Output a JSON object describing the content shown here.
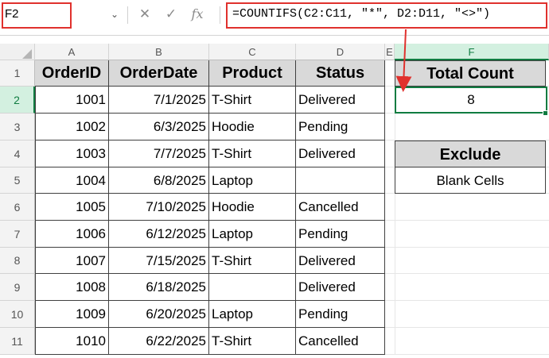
{
  "name_box": {
    "value": "F2"
  },
  "formula_bar": {
    "formula": "=COUNTIFS(C2:C11, \"*\", D2:D11, \"<>\")",
    "fx_label": "fx"
  },
  "columns": [
    "A",
    "B",
    "C",
    "D",
    "E",
    "F"
  ],
  "rows": [
    "1",
    "2",
    "3",
    "4",
    "5",
    "6",
    "7",
    "8",
    "9",
    "10",
    "11"
  ],
  "table": {
    "headers": [
      "OrderID",
      "OrderDate",
      "Product",
      "Status"
    ],
    "rows": [
      [
        "1001",
        "7/1/2025",
        "T-Shirt",
        "Delivered"
      ],
      [
        "1002",
        "6/3/2025",
        "Hoodie",
        "Pending"
      ],
      [
        "1003",
        "7/7/2025",
        "T-Shirt",
        "Delivered"
      ],
      [
        "1004",
        "6/8/2025",
        "Laptop",
        ""
      ],
      [
        "1005",
        "7/10/2025",
        "Hoodie",
        "Cancelled"
      ],
      [
        "1006",
        "6/12/2025",
        "Laptop",
        "Pending"
      ],
      [
        "1007",
        "7/15/2025",
        "T-Shirt",
        "Delivered"
      ],
      [
        "1008",
        "6/18/2025",
        "",
        "Delivered"
      ],
      [
        "1009",
        "6/20/2025",
        "Laptop",
        "Pending"
      ],
      [
        "1010",
        "6/22/2025",
        "T-Shirt",
        "Cancelled"
      ]
    ]
  },
  "total_count": {
    "label": "Total Count",
    "value": "8"
  },
  "exclude": {
    "label": "Exclude",
    "value": "Blank Cells"
  },
  "colors": {
    "highlight": "#e0312d",
    "selection": "#107c41",
    "header_fill": "#d9d9d9"
  }
}
